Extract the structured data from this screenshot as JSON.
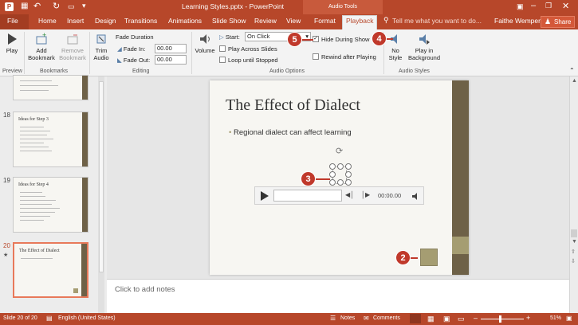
{
  "window": {
    "title": "Learning Styles.pptx - PowerPoint",
    "contextual_tab": "Audio Tools"
  },
  "tabs": [
    "File",
    "Home",
    "Insert",
    "Design",
    "Transitions",
    "Animations",
    "Slide Show",
    "Review",
    "View",
    "Format",
    "Playback"
  ],
  "active_tab": "Playback",
  "tell_me": "Tell me what you want to do...",
  "user": "Faithe Wempen",
  "share_label": "Share",
  "ribbon": {
    "preview": {
      "play": "Play",
      "label": "Preview"
    },
    "bookmarks": {
      "add": "Add Bookmark",
      "remove": "Remove Bookmark",
      "label": "Bookmarks"
    },
    "editing": {
      "trim": "Trim Audio",
      "fade_duration": "Fade Duration",
      "fade_in_label": "Fade In:",
      "fade_in_value": "00.00",
      "fade_out_label": "Fade Out:",
      "fade_out_value": "00.00",
      "label": "Editing"
    },
    "audio_options": {
      "volume": "Volume",
      "start_label": "Start:",
      "start_value": "On Click",
      "play_across": "Play Across Slides",
      "loop": "Loop until Stopped",
      "hide": "Hide During Show",
      "rewind": "Rewind after Playing",
      "label": "Audio Options"
    },
    "audio_styles": {
      "no_style": "No Style",
      "play_bg": "Play in Background",
      "label": "Audio Styles"
    }
  },
  "thumbnails": [
    {
      "num": "18",
      "title": "Ideas for Step 3"
    },
    {
      "num": "19",
      "title": "Ideas for Step 4"
    },
    {
      "num": "20",
      "title": "The Effect of Dialect"
    }
  ],
  "slide": {
    "title": "The Effect of Dialect",
    "bullet": "Regional dialect can affect learning",
    "time": "00:00.00"
  },
  "notes_placeholder": "Click to add notes",
  "callouts": [
    "2",
    "3",
    "4",
    "5"
  ],
  "status": {
    "slide": "Slide 20 of 20",
    "language": "English (United States)",
    "notes": "Notes",
    "comments": "Comments",
    "zoom": "51%"
  },
  "colors": {
    "accent": "#b7472a",
    "slide_bar": "#6e6147",
    "audio_icon": "#a59d72"
  }
}
